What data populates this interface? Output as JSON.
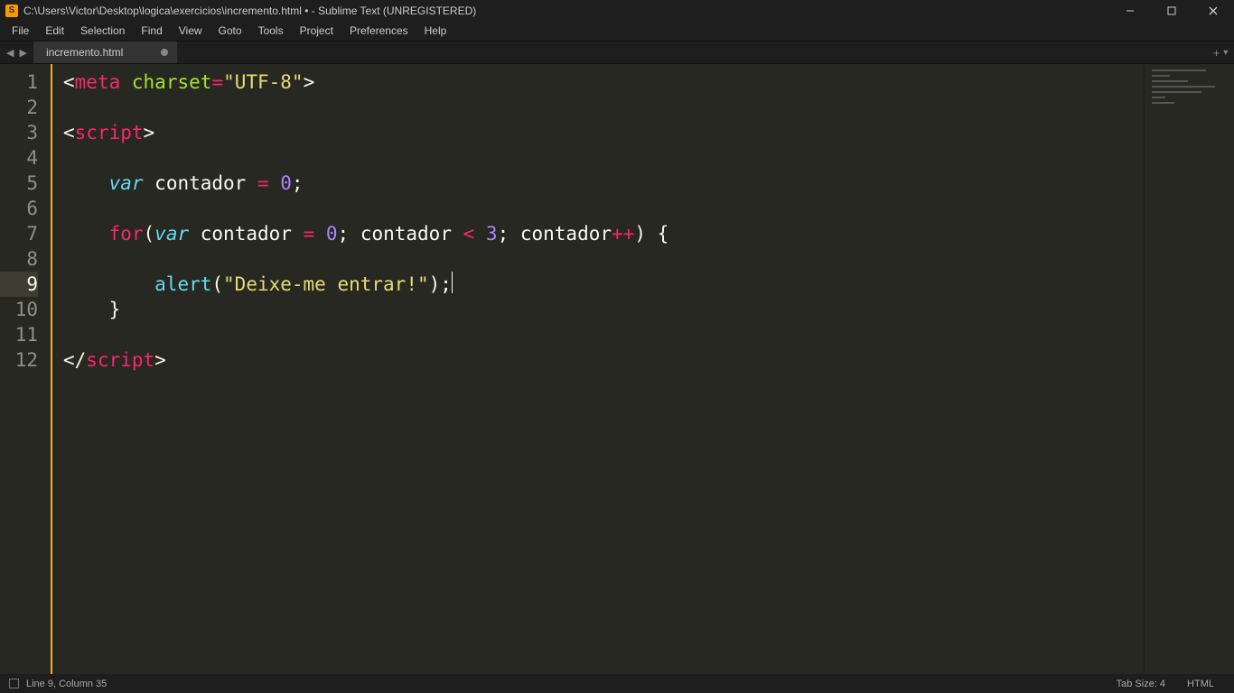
{
  "titlebar": {
    "path": "C:\\Users\\Victor\\Desktop\\logica\\exercicios\\incremento.html • - Sublime Text (UNREGISTERED)"
  },
  "menu": {
    "file": "File",
    "edit": "Edit",
    "selection": "Selection",
    "find": "Find",
    "view": "View",
    "goto": "Goto",
    "tools": "Tools",
    "project": "Project",
    "preferences": "Preferences",
    "help": "Help"
  },
  "tab": {
    "name": "incremento.html"
  },
  "gutter": {
    "l1": "1",
    "l2": "2",
    "l3": "3",
    "l4": "4",
    "l5": "5",
    "l6": "6",
    "l7": "7",
    "l8": "8",
    "l9": "9",
    "l10": "10",
    "l11": "11",
    "l12": "12"
  },
  "code": {
    "meta_tag": "meta",
    "charset_attr": "charset",
    "charset_eq": "=",
    "charset_val": "\"UTF-8\"",
    "script_tag": "script",
    "var_kw": "var",
    "contador": "contador",
    "eq": " = ",
    "zero": "0",
    "semi": ";",
    "for_kw": "for",
    "lt": " < ",
    "three": "3",
    "pp": "++",
    "alert_fn": "alert",
    "alert_str": "\"Deixe-me entrar!\"",
    "lbrace": "{",
    "rbrace": "}",
    "lt_open": "<",
    "gt_close": ">",
    "lt_close": "</",
    "lp": "(",
    "rp": ")",
    "sp": " ",
    "sp4": "    ",
    "sp8": "        ",
    "sp10": "          ",
    "comma": "; "
  },
  "status": {
    "pos": "Line 9, Column 35",
    "tab": "Tab Size: 4",
    "lang": "HTML"
  }
}
